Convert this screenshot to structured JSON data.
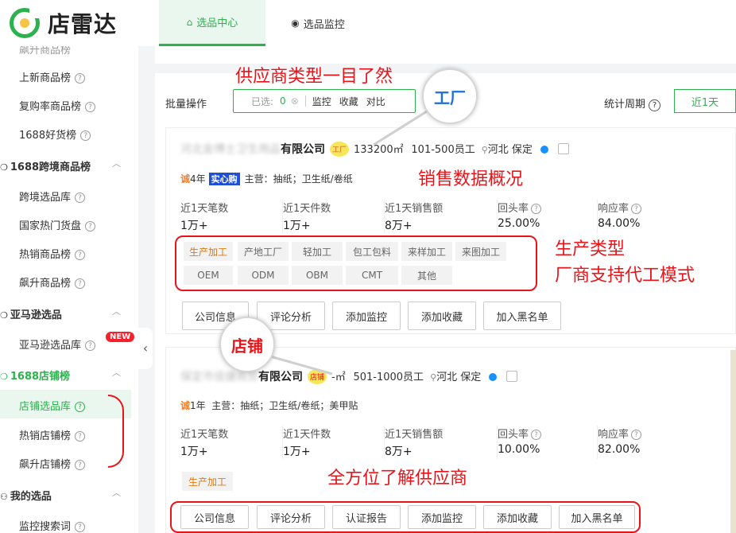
{
  "app": {
    "logo_text": "店雷达"
  },
  "tabs": [
    {
      "label": "选品中心",
      "icon": "home-icon"
    },
    {
      "label": "选品监控",
      "icon": "location-icon"
    }
  ],
  "sidebar": {
    "top_partial": "飙升商品榜",
    "items_a": [
      "上新商品榜",
      "复购率商品榜",
      "1688好货榜"
    ],
    "group_cross": "1688跨境商品榜",
    "items_cross": [
      "跨境选品库",
      "国家热门货盘",
      "热销商品榜",
      "飙升商品榜"
    ],
    "group_amazon": "亚马逊选品",
    "items_amazon": [
      "亚马逊选品库"
    ],
    "new_badge": "NEW",
    "group_shop": "1688店铺榜",
    "items_shop": [
      "店铺选品库",
      "热销店铺榜",
      "飙升店铺榜"
    ],
    "group_mine": "我的选品",
    "items_mine": [
      "监控搜索词"
    ],
    "q_mark": "?"
  },
  "toolbar": {
    "batch_label": "批量操作",
    "selected_label": "已选:",
    "selected_count": "0",
    "clear_symbol": "⊗",
    "actions": [
      "监控",
      "收藏",
      "对比"
    ],
    "period_label": "统计周期",
    "period_value": "近1天"
  },
  "cards": [
    {
      "name_blurred": "河北金博士卫生用品",
      "name_visible": "有限公司",
      "type_badge": "工厂",
      "area": "133200㎡",
      "staff": "101-500员工",
      "location": "河北 保定",
      "years": "4年",
      "cheng": "诚",
      "safe_label": "实心",
      "safe_label_2": "购",
      "main_business": "主营：抽纸；卫生纸/卷纸",
      "metrics": [
        {
          "label": "近1天笔数",
          "value": "1万+"
        },
        {
          "label": "近1天件数",
          "value": "1万+"
        },
        {
          "label": "近1天销售额",
          "value": "8万+"
        },
        {
          "label": "回头率",
          "value": "25.00%",
          "q": "?"
        },
        {
          "label": "响应率",
          "value": "84.00%",
          "q": "?"
        }
      ],
      "tags_row1": [
        "生产加工",
        "产地工厂",
        "轻加工",
        "包工包料",
        "来样加工",
        "来图加工"
      ],
      "tags_row2": [
        "OEM",
        "ODM",
        "OBM",
        "CMT",
        "其他"
      ],
      "buttons": [
        "公司信息",
        "评论分析",
        "添加监控",
        "添加收藏",
        "加入黑名单"
      ]
    },
    {
      "name_blurred": "保定市佳捷商贸",
      "name_visible": "有限公司",
      "type_badge": "店铺",
      "area": "-㎡",
      "staff": "501-1000员工",
      "location": "河北 保定",
      "years": "1年",
      "cheng": "诚",
      "main_business": "主营：抽纸；卫生纸/卷纸；美甲贴",
      "metrics": [
        {
          "label": "近1天笔数",
          "value": "1万+"
        },
        {
          "label": "近1天件数",
          "value": "1万+"
        },
        {
          "label": "近1天销售额",
          "value": "8万+"
        },
        {
          "label": "回头率",
          "value": "10.00%",
          "q": "?"
        },
        {
          "label": "响应率",
          "value": "82.00%",
          "q": "?"
        }
      ],
      "tags_row1": [
        "生产加工"
      ],
      "buttons": [
        "公司信息",
        "评论分析",
        "认证报告",
        "添加监控",
        "添加收藏",
        "加入黑名单"
      ]
    }
  ],
  "annotations": {
    "supplier_type": "供应商类型一目了然",
    "sales_overview": "销售数据概况",
    "production_type": "生产类型",
    "oem_support": "厂商支持代工模式",
    "full_understanding": "全方位了解供应商",
    "bubble_factory": "工厂",
    "bubble_shop": "店铺"
  },
  "colors": {
    "brand_green": "#2bb24c",
    "annotation_red": "#e8141a",
    "badge_yellow": "#f7e55a"
  }
}
